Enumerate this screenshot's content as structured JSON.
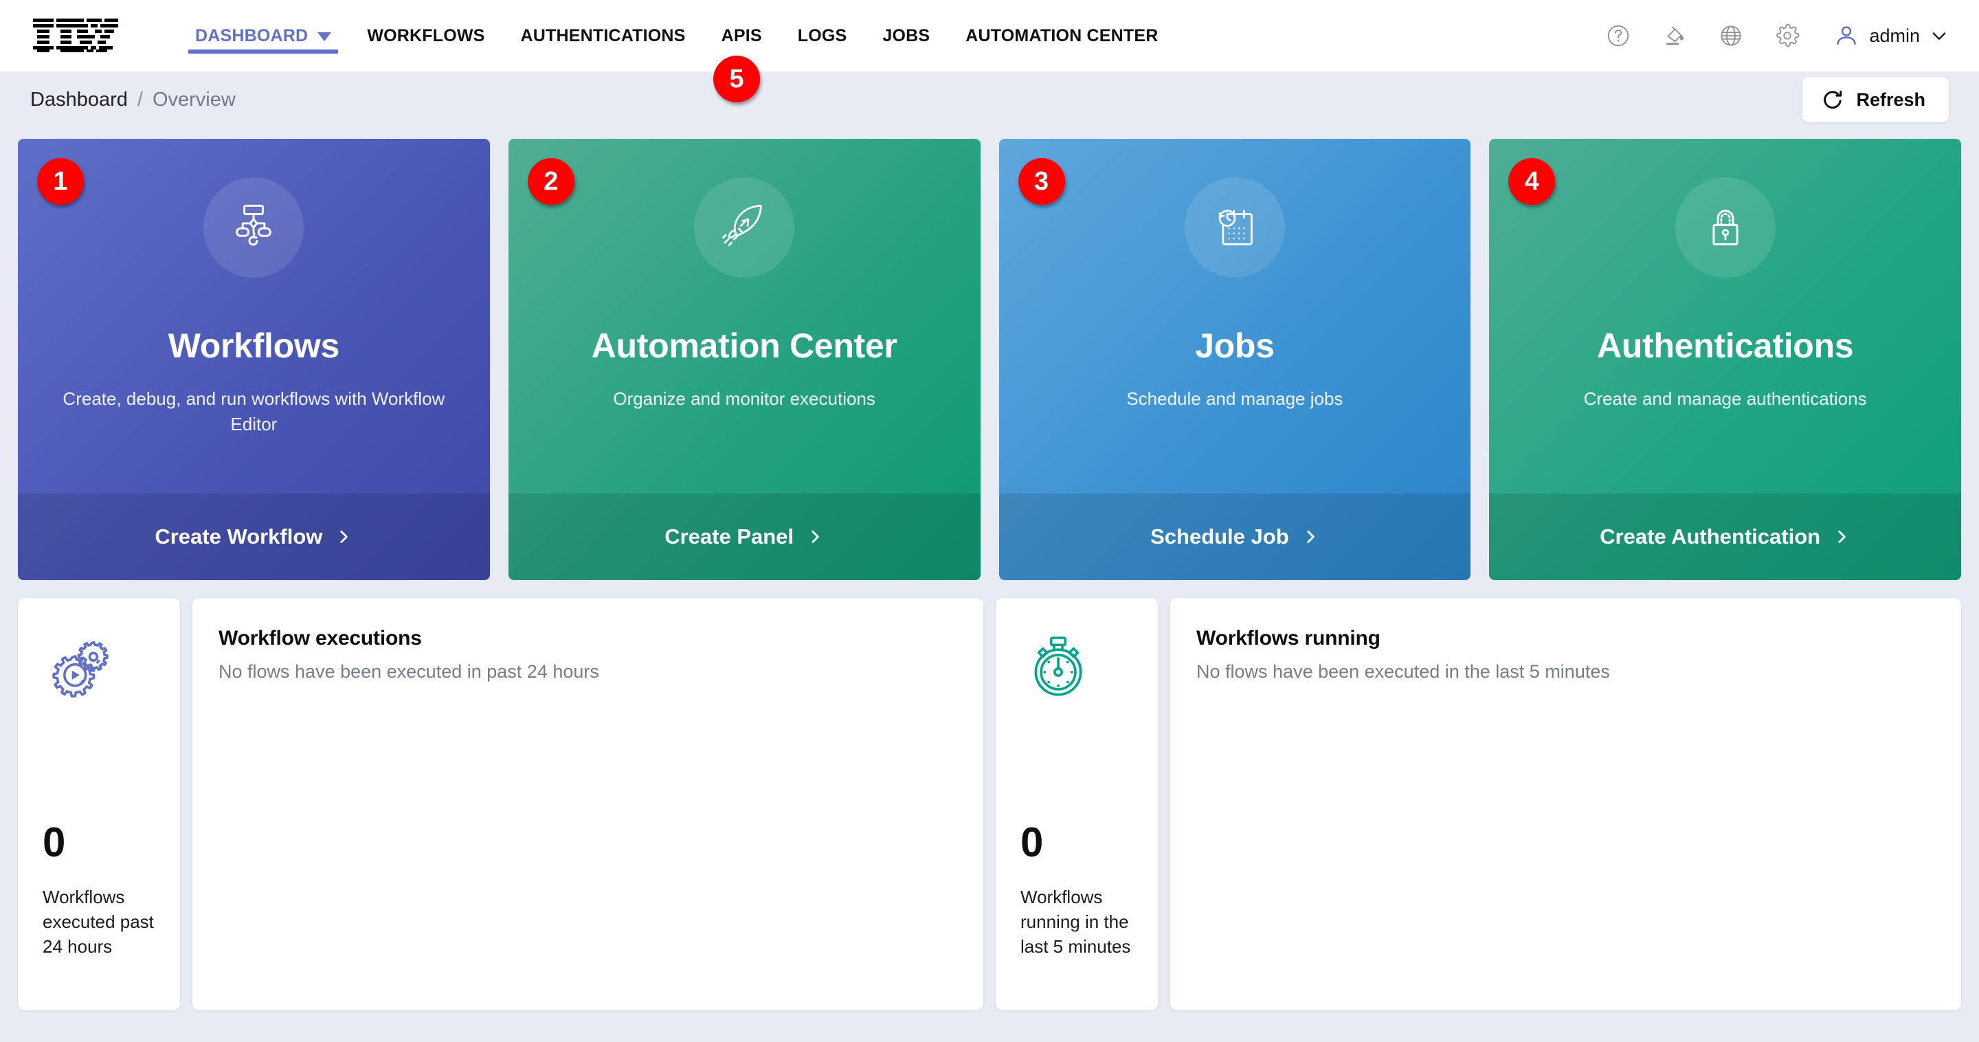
{
  "header": {
    "logo_alt": "IBM",
    "nav": [
      {
        "label": "DASHBOARD",
        "active": true,
        "has_caret": true
      },
      {
        "label": "WORKFLOWS",
        "active": false,
        "has_caret": false
      },
      {
        "label": "AUTHENTICATIONS",
        "active": false,
        "has_caret": false
      },
      {
        "label": "APIS",
        "active": false,
        "has_caret": false
      },
      {
        "label": "LOGS",
        "active": false,
        "has_caret": false
      },
      {
        "label": "JOBS",
        "active": false,
        "has_caret": false
      },
      {
        "label": "AUTOMATION CENTER",
        "active": false,
        "has_caret": false
      }
    ],
    "icons": [
      "help-icon",
      "theme-icon",
      "globe-icon",
      "gear-icon"
    ],
    "user": {
      "name": "admin",
      "avatar": "person-icon",
      "chevron": "chevron-down-icon"
    },
    "accent_color": "#6071c7"
  },
  "breadcrumb": {
    "root": "Dashboard",
    "separator": "/",
    "current": "Overview"
  },
  "toolbar": {
    "refresh_label": "Refresh",
    "refresh_icon": "refresh-icon"
  },
  "hero_cards": [
    {
      "marker": "1",
      "title": "Workflows",
      "subtitle": "Create, debug, and run workflows with Workflow Editor",
      "action": "Create Workflow",
      "icon": "flowchart-icon",
      "color_from": "#5f6fc9",
      "color_to": "#3b44a5"
    },
    {
      "marker": "2",
      "title": "Automation Center",
      "subtitle": "Organize and monitor executions",
      "action": "Create Panel",
      "icon": "rocket-icon",
      "color_from": "#4eab92",
      "color_to": "#109b75"
    },
    {
      "marker": "3",
      "title": "Jobs",
      "subtitle": "Schedule and manage jobs",
      "action": "Schedule Job",
      "icon": "calendar-clock-icon",
      "color_from": "#5ba4da",
      "color_to": "#2d88cc"
    },
    {
      "marker": "4",
      "title": "Authentications",
      "subtitle": "Create and manage authentications",
      "action": "Create Authentication",
      "icon": "lock-icon",
      "color_from": "#4dab93",
      "color_to": "#11a07b"
    }
  ],
  "nav_marker": "5",
  "widgets": {
    "executed_stat": {
      "icon": "gears-play-icon",
      "icon_color": "#6071c7",
      "value": "0",
      "label": "Workflows executed past 24 hours"
    },
    "executions_panel": {
      "title": "Workflow executions",
      "empty_message": "No flows have been executed in past 24 hours"
    },
    "running_stat": {
      "icon": "stopwatch-icon",
      "icon_color": "#00a48a",
      "value": "0",
      "label": "Workflows running in the last 5 minutes"
    },
    "running_panel": {
      "title": "Workflows running",
      "empty_message": "No flows have been executed in the last 5 minutes"
    }
  }
}
